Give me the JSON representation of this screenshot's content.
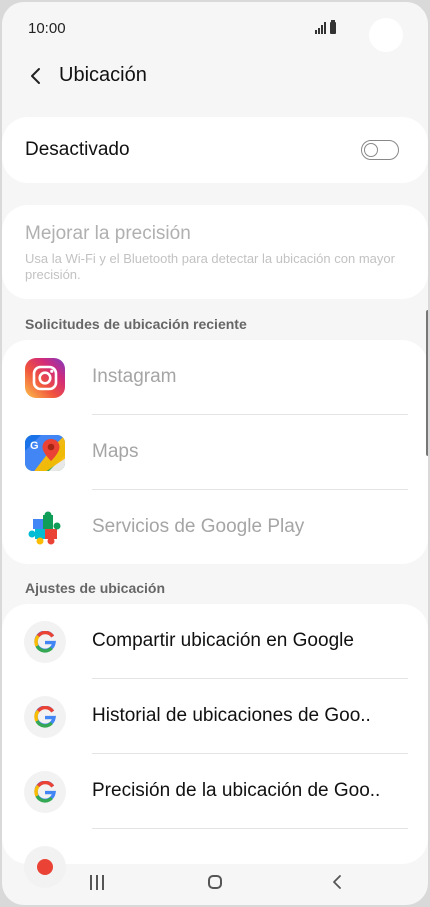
{
  "status_bar": {
    "time": "10:00"
  },
  "header": {
    "title": "Ubicación"
  },
  "location_master": {
    "label": "Desactivado",
    "enabled": false
  },
  "accuracy": {
    "title": "Mejorar la precisión",
    "description": "Usa la Wi-Fi y el Bluetooth para detectar la ubicación con mayor precisión."
  },
  "recent_requests": {
    "header": "Solicitudes de ubicación reciente",
    "items": [
      {
        "label": "Instagram",
        "icon": "instagram-icon"
      },
      {
        "label": "Maps",
        "icon": "maps-icon"
      },
      {
        "label": "Servicios de Google Play",
        "icon": "google-play-services-icon"
      }
    ]
  },
  "location_settings": {
    "header": "Ajustes de ubicación",
    "items": [
      {
        "label": "Compartir ubicación en Google",
        "icon": "google-icon"
      },
      {
        "label": "Historial de ubicaciones de Goo..",
        "icon": "google-icon"
      },
      {
        "label": "Precisión de la ubicación de Goo..",
        "icon": "google-icon"
      }
    ]
  },
  "nav": {
    "recents": "recents-icon",
    "home": "home-icon",
    "back": "back-icon"
  }
}
